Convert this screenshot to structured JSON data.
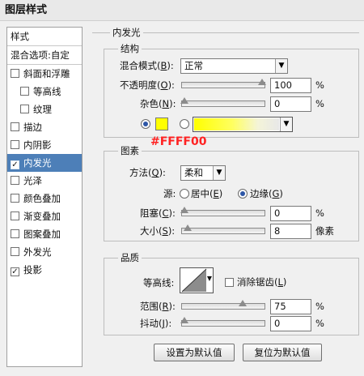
{
  "window": {
    "title": "图层样式"
  },
  "sidebar": {
    "header": "样式",
    "blend_options": "混合选项:自定",
    "items": [
      {
        "label": "斜面和浮雕",
        "checked": false
      },
      {
        "label": "等高线",
        "checked": false
      },
      {
        "label": "纹理",
        "checked": false
      },
      {
        "label": "描边",
        "checked": false
      },
      {
        "label": "内阴影",
        "checked": false
      },
      {
        "label": "内发光",
        "checked": true
      },
      {
        "label": "光泽",
        "checked": false
      },
      {
        "label": "颜色叠加",
        "checked": false
      },
      {
        "label": "渐变叠加",
        "checked": false
      },
      {
        "label": "图案叠加",
        "checked": false
      },
      {
        "label": "外发光",
        "checked": false
      },
      {
        "label": "投影",
        "checked": true
      }
    ],
    "check_mark": "✓"
  },
  "inner_glow": {
    "title": "内发光",
    "structure": {
      "title": "结构",
      "blend_mode_label": "混合模式",
      "blend_mode_key": "B",
      "blend_mode_value": "正常",
      "opacity_label": "不透明度",
      "opacity_key": "O",
      "opacity_value": "100",
      "opacity_fraction": 1.0,
      "noise_label": "杂色",
      "noise_key": "N",
      "noise_value": "0",
      "noise_fraction": 0.0,
      "percent": "%",
      "color_hex": "#FFFF00",
      "color_annotation": "#FFFF00"
    },
    "elements": {
      "title": "图素",
      "technique_label": "方法",
      "technique_key": "Q",
      "technique_value": "柔和",
      "source_label": "源:",
      "source_center_label": "居中",
      "source_center_key": "E",
      "source_edge_label": "边缘",
      "source_edge_key": "G",
      "choke_label": "阻塞",
      "choke_key": "C",
      "choke_value": "0",
      "choke_fraction": 0.0,
      "size_label": "大小",
      "size_key": "S",
      "size_value": "8",
      "size_fraction": 0.04,
      "size_unit": "像素",
      "percent": "%"
    },
    "quality": {
      "title": "品质",
      "contour_label": "等高线:",
      "antialias_label": "消除锯齿",
      "antialias_key": "L",
      "range_label": "范围",
      "range_key": "R",
      "range_value": "75",
      "range_fraction": 0.75,
      "jitter_label": "抖动",
      "jitter_key": "J",
      "jitter_value": "0",
      "jitter_fraction": 0.0,
      "percent": "%"
    },
    "buttons": {
      "make_default": "设置为默认值",
      "reset_default": "复位为默认值"
    }
  },
  "colors": {
    "selection": "#4d7fb8",
    "glow": "#FFFF00",
    "annotation": "#ff2222"
  },
  "icons": {
    "dropdown_arrow": "▼"
  }
}
